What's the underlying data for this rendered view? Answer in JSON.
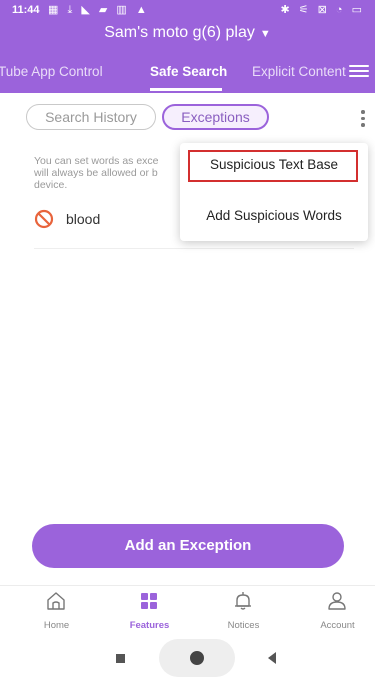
{
  "status_bar": {
    "time": "11:44",
    "left_icons": "▦ ⤓ ◣ ▰ ▥ ▲",
    "right_icons": "✱ ⚟ ⊠ ◔ ▭"
  },
  "header": {
    "device_name": "Sam's moto g(6) play",
    "device_caret": "▼",
    "tabs": [
      {
        "label": "Tube App Control",
        "active": false
      },
      {
        "label": "Safe Search",
        "active": true
      },
      {
        "label": "Explicit Content",
        "active": false
      }
    ],
    "menu_icon": "hamburger-icon"
  },
  "filters": {
    "chips": [
      {
        "label": "Search History",
        "selected": false
      },
      {
        "label": "Exceptions",
        "selected": true
      }
    ],
    "more_icon": "kebab-menu-icon"
  },
  "content": {
    "info_lines": [
      "You can set words as exce",
      "will always be allowed or b",
      "device."
    ],
    "exceptions": [
      {
        "word": "blood",
        "icon": "prohibited-icon"
      }
    ]
  },
  "popup_menu": {
    "items": [
      {
        "label": "Suspicious Text Base",
        "highlighted": true
      },
      {
        "label": "Add Suspicious Words",
        "highlighted": false
      }
    ]
  },
  "actions": {
    "add_exception_label": "Add an Exception"
  },
  "bottom_nav": {
    "items": [
      {
        "label": "Home",
        "icon": "home-icon",
        "active": false
      },
      {
        "label": "Features",
        "icon": "features-icon",
        "active": true
      },
      {
        "label": "Notices",
        "icon": "bell-icon",
        "active": false
      },
      {
        "label": "Account",
        "icon": "account-icon",
        "active": false
      }
    ]
  },
  "colors": {
    "primary": "#9b63db",
    "highlight_border": "#d32f2f",
    "prohibited": "#e8643c"
  }
}
